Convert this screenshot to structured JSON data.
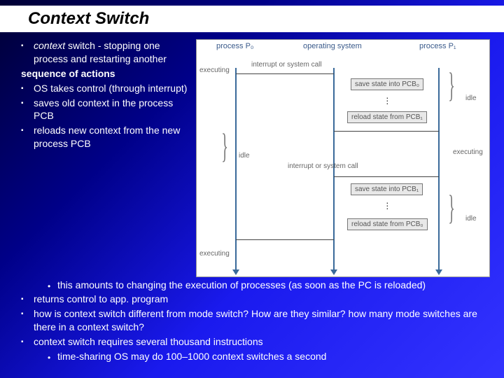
{
  "title": "Context Switch",
  "bullets": {
    "b1_em": "context",
    "b1_rest": " switch - stopping one process and restarting another",
    "seq": "sequence of actions",
    "b2": "OS takes control (through interrupt)",
    "b3": "saves old context in the process PCB",
    "b4": "reloads new context from the new process PCB",
    "b4_sub": "this amounts to changing the execution of processes (as soon as the PC is reloaded)",
    "b5": "returns control to app. program",
    "b6": "how is context switch different from mode switch? How are they similar? how many mode switches are there in a context switch?",
    "b7": "context switch requires several thousand instructions",
    "b7_sub": "time-sharing OS may do 100–1000 context switches a second"
  },
  "diagram": {
    "header_p0": "process P₀",
    "header_os": "operating system",
    "header_p1": "process P₁",
    "event1": "interrupt or system call",
    "event2": "interrupt or system call",
    "box_save0": "save state into PCB₀",
    "box_reload1": "reload state from PCB₁",
    "box_save1": "save state into PCB₁",
    "box_reload0": "reload state from PCB₀",
    "executing": "executing",
    "idle": "idle"
  }
}
